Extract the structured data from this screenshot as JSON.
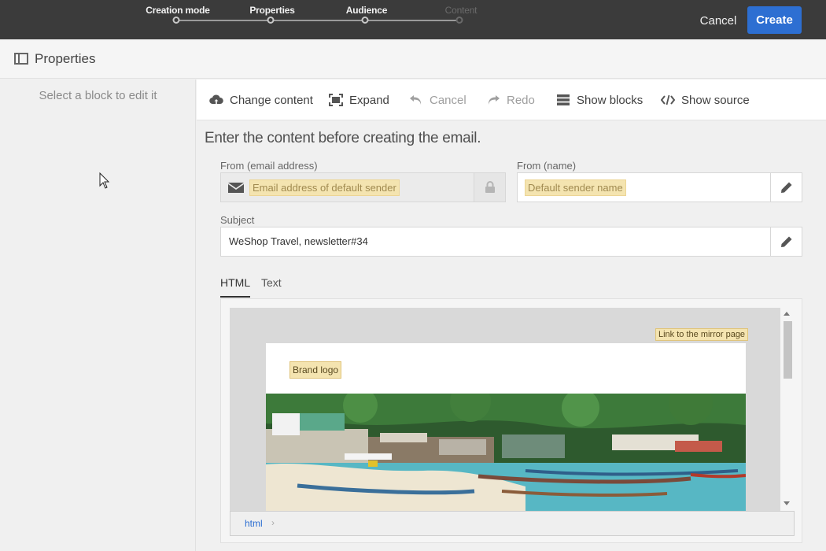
{
  "wizard": {
    "steps": [
      {
        "label": "Creation mode",
        "state": "done"
      },
      {
        "label": "Properties",
        "state": "done"
      },
      {
        "label": "Audience",
        "state": "current"
      },
      {
        "label": "Content",
        "state": "upcoming"
      }
    ],
    "cancel_label": "Cancel",
    "create_label": "Create",
    "accent_color": "#2d6fd2"
  },
  "properties_panel": {
    "title": "Properties",
    "hint": "Select a block to edit it"
  },
  "toolbar": {
    "change_content": "Change content",
    "expand": "Expand",
    "cancel": "Cancel",
    "redo": "Redo",
    "show_blocks": "Show blocks",
    "show_source": "Show source"
  },
  "form": {
    "intro": "Enter the content before creating the email.",
    "from_email": {
      "label": "From (email address)",
      "placeholder": "Email address of default sender",
      "icon": "envelope-icon",
      "lock_icon": "lock-icon"
    },
    "from_name": {
      "label": "From (name)",
      "placeholder": "Default sender name",
      "icon": "pencil-icon"
    },
    "subject": {
      "label": "Subject",
      "value": "WeShop Travel, newsletter#34",
      "icon": "pencil-icon"
    }
  },
  "editor": {
    "tabs": [
      {
        "label": "HTML",
        "active": true
      },
      {
        "label": "Text",
        "active": false
      }
    ],
    "mirror_link": "Link to the mirror page",
    "brand_logo": "Brand logo",
    "hero_image": "beach-boats-photo",
    "path": "html"
  }
}
